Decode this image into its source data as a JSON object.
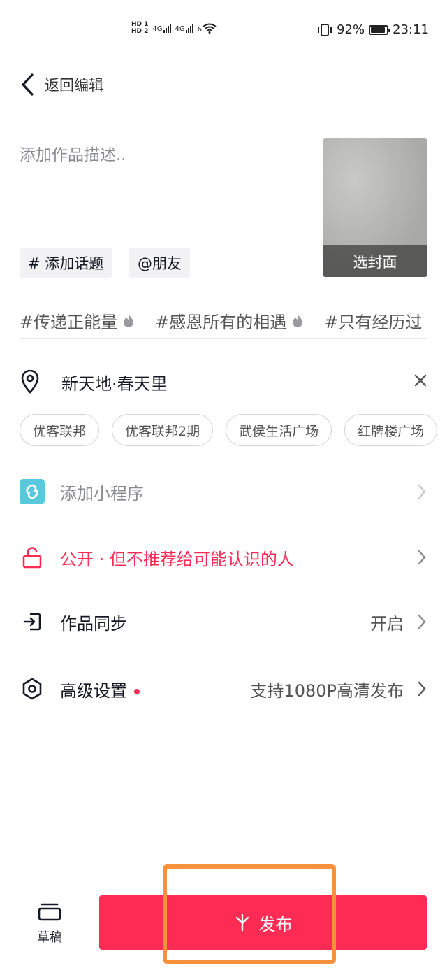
{
  "status_bar": {
    "hd1": "HD 1",
    "hd2": "HD 2",
    "net1": "4G",
    "net2": "4G",
    "wifi_tag": "6",
    "battery": "92%",
    "battery_level": 0.92,
    "time": "23:11"
  },
  "header": {
    "back_label": "返回编辑"
  },
  "editor": {
    "description_placeholder": "添加作品描述..",
    "hashtag_button": "# 添加话题",
    "mention_button": "@朋友",
    "cover_label": "选封面"
  },
  "hot_topics": [
    "#传递正能量",
    "#感恩所有的相遇",
    "#只有经历过"
  ],
  "location": {
    "name": "新天地·春天里",
    "suggestions": [
      "优客联邦",
      "优客联邦2期",
      "武侯生活广场",
      "红牌楼广场"
    ]
  },
  "settings": {
    "mini_program": "添加小程序",
    "privacy": "公开 · 但不推荐给可能认识的人",
    "sync_label": "作品同步",
    "sync_value": "开启",
    "advanced_label": "高级设置",
    "advanced_value": "支持1080P高清发布"
  },
  "bottom": {
    "draft_label": "草稿",
    "publish_label": "发布"
  },
  "colors": {
    "accent": "#fe2c55",
    "highlight": "#f7913d",
    "mini_program_icon": "#5ac8dc"
  }
}
